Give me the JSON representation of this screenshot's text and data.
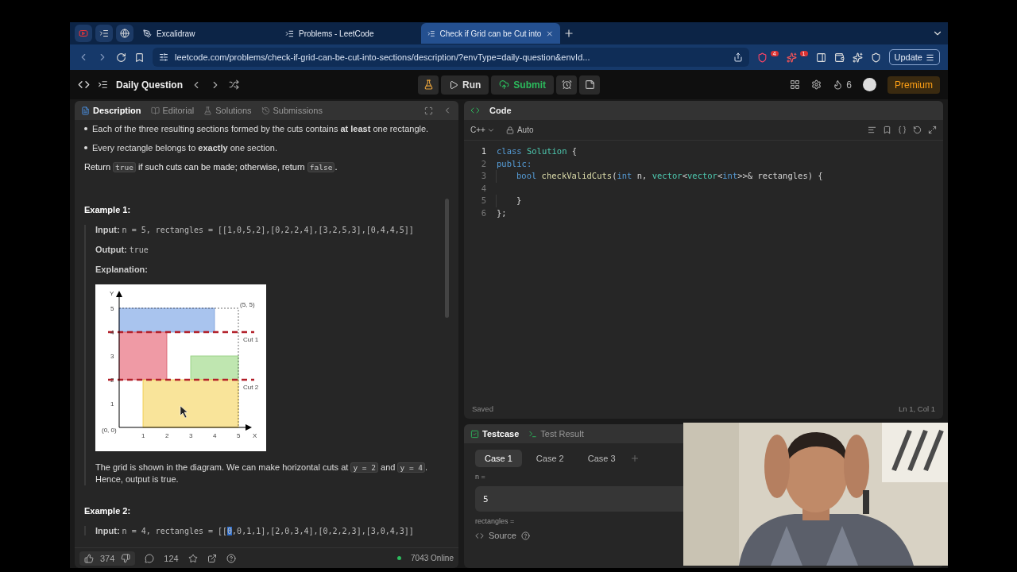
{
  "browser": {
    "tabs": [
      {
        "kind": "pinned",
        "selected": false
      },
      {
        "kind": "pinned",
        "selected": false
      },
      {
        "kind": "pinned",
        "selected": false
      },
      {
        "kind": "page",
        "label": "Excalidraw",
        "selected": false
      },
      {
        "kind": "page",
        "label": "Problems - LeetCode",
        "selected": false
      },
      {
        "kind": "page",
        "label": "Check if Grid can be Cut into",
        "selected": true
      }
    ],
    "address": "leetcode.com/problems/check-if-grid-can-be-cut-into-sections/description/?envType=daily-question&envId...",
    "badges": [
      "4",
      "1"
    ],
    "update_button": "Update"
  },
  "toolbar": {
    "title": "Daily Question",
    "run": "Run",
    "submit": "Submit",
    "streak": "6",
    "premium": "Premium"
  },
  "description_panel": {
    "tabs": [
      {
        "label": "Description",
        "selected": true
      },
      {
        "label": "Editorial",
        "selected": false
      },
      {
        "label": "Solutions",
        "selected": false
      },
      {
        "label": "Submissions",
        "selected": false
      }
    ],
    "bullets": [
      "Each of the three resulting sections formed by the cuts contains **at least** one rectangle.",
      "Every rectangle belongs to **exactly** one section."
    ],
    "return_line": [
      {
        "kind": "text",
        "text": "Return "
      },
      {
        "kind": "code",
        "text": "true"
      },
      {
        "kind": "text",
        "text": " if such cuts can be made; otherwise, return "
      },
      {
        "kind": "code",
        "text": "false"
      },
      {
        "kind": "text",
        "text": "."
      }
    ],
    "example_1": {
      "title": "Example 1:",
      "input_label": "Input:",
      "input": [
        {
          "text": "n = 5, rectangles = [[1,0,5,2],[0,2,2,4],[3,2,5,3],[0,4,4,5]]",
          "selected": false
        }
      ],
      "output_label": "Output:",
      "output": "true",
      "explanation_label": "Explanation:",
      "diagram": {
        "y_label": "Y",
        "x_label": "X",
        "y_ticks": [
          "5",
          "4",
          "3",
          "2",
          "1"
        ],
        "x_ticks": [
          "1",
          "2",
          "3",
          "4",
          "5"
        ],
        "origin": "(0, 0)",
        "corner": "(5, 5)",
        "cuts": [
          "Cut 1",
          "Cut 2"
        ]
      },
      "explanation": [
        {
          "kind": "text",
          "text": "The grid is shown in the diagram. We can make horizontal cuts at "
        },
        {
          "kind": "code",
          "text": "y = 2"
        },
        {
          "kind": "text",
          "text": " and "
        },
        {
          "kind": "code",
          "text": "y = 4"
        },
        {
          "kind": "text",
          "text": ". Hence, output is true."
        }
      ]
    },
    "example_2": {
      "title": "Example 2:",
      "input_label": "Input:",
      "input": [
        {
          "text": "n = 4, rectangles = [[",
          "selected": false
        },
        {
          "text": "0",
          "selected": true
        },
        {
          "text": ",0,1,1],[2,0,3,4],[0,2,2,3],[3,0,4,3]]",
          "selected": false
        }
      ]
    },
    "footer": {
      "likes": "374",
      "comments": "124",
      "online": "7043 Online"
    }
  },
  "code_panel": {
    "title": "Code",
    "language": "C++",
    "mode": "Auto",
    "lines": [
      {
        "number": "1",
        "indented": false,
        "tokens": [
          {
            "kind": "keyword",
            "text": "class "
          },
          {
            "kind": "type",
            "text": "Solution"
          },
          {
            "kind": "plain",
            "text": " {"
          }
        ]
      },
      {
        "number": "2",
        "indented": false,
        "tokens": [
          {
            "kind": "keyword",
            "text": "public:"
          }
        ]
      },
      {
        "number": "3",
        "indented": true,
        "tokens": [
          {
            "kind": "keyword",
            "text": "bool "
          },
          {
            "kind": "function",
            "text": "checkValidCuts"
          },
          {
            "kind": "plain",
            "text": "("
          },
          {
            "kind": "keyword",
            "text": "int"
          },
          {
            "kind": "plain",
            "text": " n, "
          },
          {
            "kind": "type",
            "text": "vector"
          },
          {
            "kind": "plain",
            "text": "<"
          },
          {
            "kind": "type",
            "text": "vector"
          },
          {
            "kind": "plain",
            "text": "<"
          },
          {
            "kind": "keyword",
            "text": "int"
          },
          {
            "kind": "plain",
            "text": ">>& rectangles) {"
          }
        ]
      },
      {
        "number": "4"
      },
      {
        "number": "5",
        "indented": true,
        "tokens": [
          {
            "kind": "plain",
            "text": "}"
          }
        ]
      },
      {
        "number": "6",
        "indented": false,
        "tokens": [
          {
            "kind": "plain",
            "text": "};"
          }
        ]
      }
    ],
    "status": "Saved",
    "cursor": "Ln 1, Col 1"
  },
  "test_panel": {
    "tabs": [
      {
        "label": "Testcase",
        "selected": true
      },
      {
        "label": "Test Result",
        "selected": false
      }
    ],
    "cases": [
      {
        "label": "Case 1",
        "selected": true
      },
      {
        "label": "Case 2",
        "selected": false
      },
      {
        "label": "Case 3",
        "selected": false
      }
    ],
    "params": [
      {
        "name": "n =",
        "value": "5"
      },
      {
        "name": "rectangles ="
      }
    ],
    "source": "Source"
  }
}
